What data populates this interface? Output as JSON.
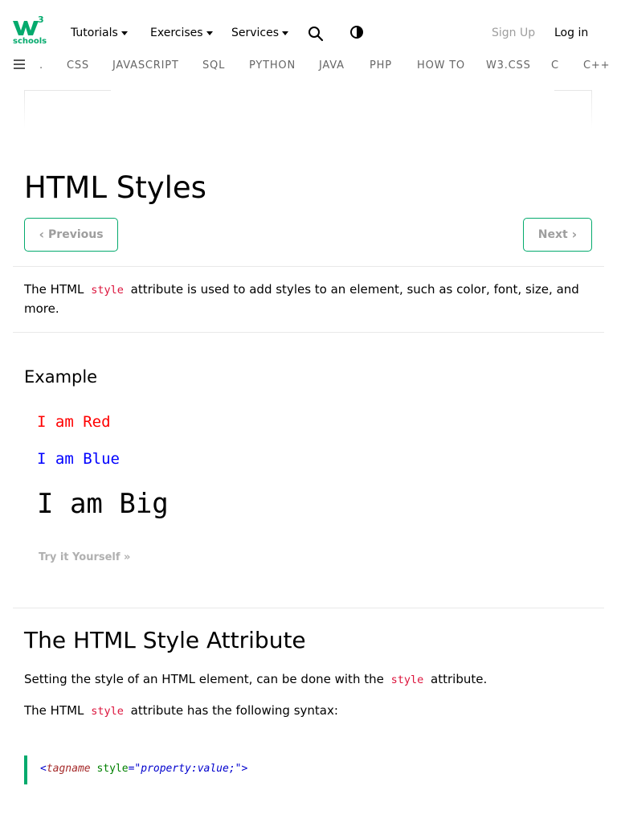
{
  "brand": {
    "name": "W3Schools",
    "logo_text": "schools",
    "superscript": "3",
    "accent_color": "#04AA6D"
  },
  "topnav": {
    "items": [
      "Tutorials",
      "Exercises",
      "Services"
    ],
    "search_icon": "search-icon",
    "contrast_icon": "contrast-icon",
    "signup": "Sign Up",
    "login": "Log in"
  },
  "subnav": {
    "menu_icon": "hamburger-menu-icon",
    "items": [
      ".",
      "CSS",
      "JAVASCRIPT",
      "SQL",
      "PYTHON",
      "JAVA",
      "PHP",
      "HOW TO",
      "W3.CSS",
      "C",
      "C++"
    ]
  },
  "page": {
    "title": "HTML Styles",
    "prev_label": "Previous",
    "next_label": "Next",
    "intro_before": "The HTML",
    "intro_code": "style",
    "intro_after": "attribute is used to add styles to an element, such as color, font, size, and more."
  },
  "example": {
    "heading": "Example",
    "red": "I am Red",
    "blue": "I am Blue",
    "big": "I am Big",
    "red_color": "#ff0000",
    "blue_color": "#0000ff",
    "tryit": "Try it Yourself »"
  },
  "section2": {
    "heading": "The HTML Style Attribute",
    "p1_before": "Setting the style of an HTML element, can be done with the",
    "p1_code": "style",
    "p1_after": "attribute.",
    "p2_before": "The HTML",
    "p2_code": "style",
    "p2_after": "attribute has the following syntax:"
  },
  "syntax": {
    "open": "<",
    "tag": "tagname",
    "attr": "style",
    "eq": "=",
    "value": "\"property:value;\"",
    "close": ">"
  }
}
